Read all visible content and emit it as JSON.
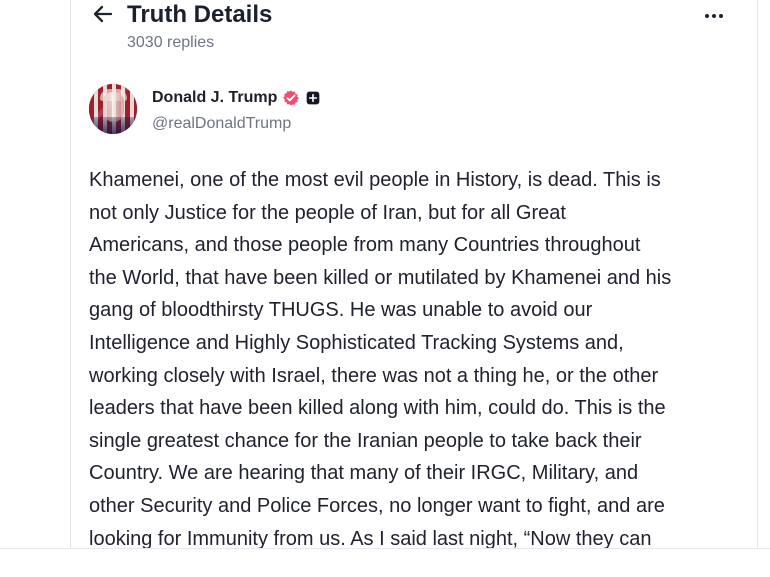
{
  "header": {
    "title": "Truth Details",
    "reply_count": "3030 replies",
    "back_icon": "arrow-left-icon",
    "more_icon": "more-horizontal-icon"
  },
  "author": {
    "name": "Donald J. Trump",
    "handle": "@realDonaldTrump",
    "verified_icon": "verified-badge-icon",
    "plus_icon": "plus-badge-icon",
    "accent_color": "#ea4f74"
  },
  "post": {
    "lines": [
      "Khamenei, one of the most evil people in History, is dead. This is",
      "not only Justice for the people of Iran, but for all Great",
      "Americans, and those people from many Countries throughout",
      "the World, that have been killed or mutilated by Khamenei and his",
      "gang of bloodthirsty THUGS. He was unable to avoid our",
      "Intelligence and Highly Sophisticated Tracking Systems and,",
      "working closely with Israel, there was not a thing he, or the other",
      "leaders that have been killed along with him, could do. This is the",
      "single greatest chance for the Iranian people to take back their",
      "Country. We are hearing that many of their IRGC, Military, and",
      "other Security and Police Forces, no longer want to fight, and are",
      "looking for Immunity from us. As I said last night, “Now they can"
    ]
  }
}
